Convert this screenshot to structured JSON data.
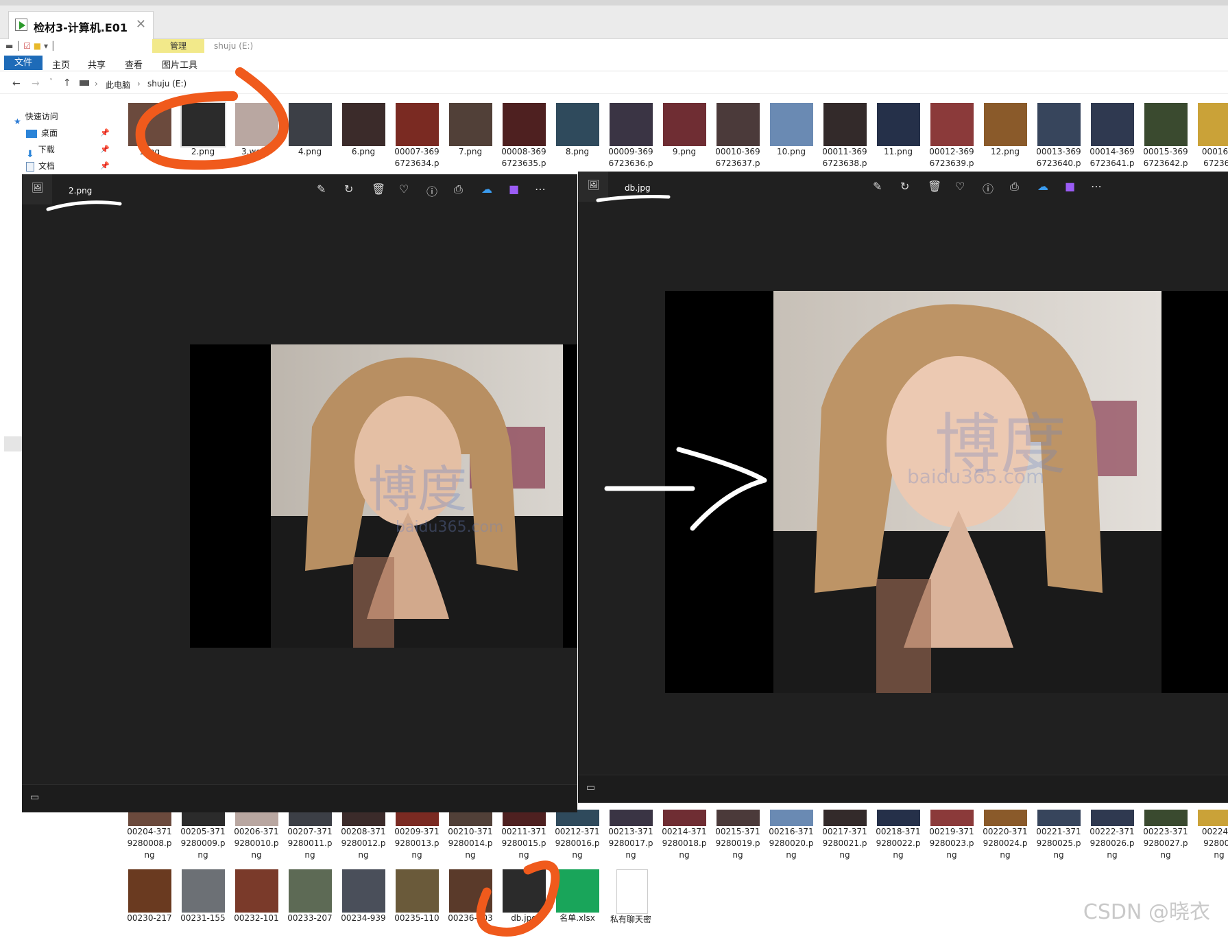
{
  "window": {
    "title": "检材3-计算机.E01",
    "close_glyph": "✕"
  },
  "ribbon": {
    "context_group": "管理",
    "context_window": "shuju (E:)",
    "file_tab": "文件",
    "tabs": [
      "主页",
      "共享",
      "查看",
      "图片工具"
    ]
  },
  "address": {
    "crumbs": [
      "此电脑",
      "shuju (E:)"
    ]
  },
  "nav": {
    "items": [
      {
        "label": "快速访问",
        "icon": "star-icon"
      },
      {
        "label": "桌面",
        "icon": "desktop-icon"
      },
      {
        "label": "下载",
        "icon": "download-icon"
      },
      {
        "label": "文档",
        "icon": "document-icon"
      }
    ]
  },
  "files_top": [
    [
      "1.jpg"
    ],
    [
      "2.png"
    ],
    [
      "3.webp"
    ],
    [
      "4.png"
    ],
    [
      "6.png"
    ],
    [
      "00007-369",
      "6723634.p"
    ],
    [
      "7.png"
    ],
    [
      "00008-369",
      "6723635.p"
    ],
    [
      "8.png"
    ],
    [
      "00009-369",
      "6723636.p"
    ],
    [
      "9.png"
    ],
    [
      "00010-369",
      "6723637.p"
    ],
    [
      "10.png"
    ],
    [
      "00011-369",
      "6723638.p"
    ],
    [
      "11.png"
    ],
    [
      "00012-369",
      "6723639.p"
    ],
    [
      "12.png"
    ],
    [
      "00013-369",
      "6723640.p"
    ],
    [
      "00014-369",
      "6723641.p"
    ],
    [
      "00015-369",
      "6723642.p"
    ],
    [
      "00016-3",
      "672364"
    ]
  ],
  "files_mid": [
    [
      "00204-371",
      "9280008.p",
      "ng"
    ],
    [
      "00205-371",
      "9280009.p",
      "ng"
    ],
    [
      "00206-371",
      "9280010.p",
      "ng"
    ],
    [
      "00207-371",
      "9280011.p",
      "ng"
    ],
    [
      "00208-371",
      "9280012.p",
      "ng"
    ],
    [
      "00209-371",
      "9280013.p",
      "ng"
    ],
    [
      "00210-371",
      "9280014.p",
      "ng"
    ],
    [
      "00211-371",
      "9280015.p",
      "ng"
    ],
    [
      "00212-371",
      "9280016.p",
      "ng"
    ],
    [
      "00213-371",
      "9280017.p",
      "ng"
    ],
    [
      "00214-371",
      "9280018.p",
      "ng"
    ],
    [
      "00215-371",
      "9280019.p",
      "ng"
    ],
    [
      "00216-371",
      "9280020.p",
      "ng"
    ],
    [
      "00217-371",
      "9280021.p",
      "ng"
    ],
    [
      "00218-371",
      "9280022.p",
      "ng"
    ],
    [
      "00219-371",
      "9280023.p",
      "ng"
    ],
    [
      "00220-371",
      "9280024.p",
      "ng"
    ],
    [
      "00221-371",
      "9280025.p",
      "ng"
    ],
    [
      "00222-371",
      "9280026.p",
      "ng"
    ],
    [
      "00223-371",
      "9280027.p",
      "ng"
    ],
    [
      "00224-3",
      "928002",
      "ng"
    ]
  ],
  "files_bottom": [
    "00230-217",
    "00231-155",
    "00232-101",
    "00233-207",
    "00234-939",
    "00235-110",
    "00236-203",
    "db.jpg",
    "名单.xlsx",
    "私有聊天密"
  ],
  "viewer_left": {
    "title": "2.png",
    "watermark": "博度",
    "watermark_url": "baidu365.com"
  },
  "viewer_right": {
    "title": "db.jpg",
    "watermark": "博度",
    "watermark_url": "baidu365.com"
  },
  "toolbar_icons": [
    "edit-icon",
    "rotate-icon",
    "delete-icon",
    "favorite-icon",
    "info-icon",
    "print-icon",
    "onedrive-icon",
    "clipchamp-icon",
    "more-icon"
  ],
  "page_watermark": "CSDN @晓衣",
  "colors": {
    "annotation": "#f05a1c",
    "viewer_bg": "#202020",
    "ribbon_file": "#1e6bb8"
  }
}
